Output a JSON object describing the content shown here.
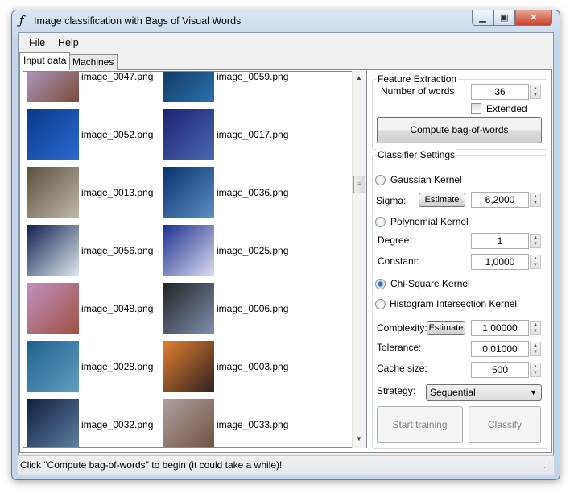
{
  "window": {
    "title": "Image classification with Bags of Visual Words",
    "icon": "script-f-icon",
    "minimize": "minimize-icon",
    "maximize": "maximize-icon",
    "close": "close-icon"
  },
  "menu": [
    "File",
    "Help"
  ],
  "tabs": [
    {
      "label": "Input data",
      "active": true
    },
    {
      "label": "Machines",
      "active": false
    }
  ],
  "images": [
    [
      "image_0047.png",
      "image_0059.png"
    ],
    [
      "image_0052.png",
      "image_0017.png"
    ],
    [
      "image_0013.png",
      "image_0036.png"
    ],
    [
      "image_0056.png",
      "image_0025.png"
    ],
    [
      "image_0048.png",
      "image_0006.png"
    ],
    [
      "image_0028.png",
      "image_0003.png"
    ],
    [
      "image_0032.png",
      "image_0033.png"
    ]
  ],
  "feature": {
    "title": "Feature Extraction",
    "words_label": "Number of words",
    "words": "36",
    "extended": "Extended",
    "extended_checked": false,
    "compute": "Compute bag-of-words"
  },
  "classifier": {
    "title": "Classifier Settings",
    "gaussian": "Gaussian Kernel",
    "sigma_label": "Sigma:",
    "estimate": "Estimate",
    "sigma": "6,2000",
    "polynomial": "Polynomial Kernel",
    "degree_label": "Degree:",
    "degree": "1",
    "constant_label": "Constant:",
    "constant": "1,0000",
    "chi": "Chi-Square Kernel",
    "histogram": "Histogram Intersection Kernel",
    "selected_kernel": "Chi-Square Kernel",
    "complexity_label": "Complexity:",
    "complexity": "1,00000",
    "tolerance_label": "Tolerance:",
    "tolerance": "0,01000",
    "cache_label": "Cache size:",
    "cache": "500",
    "strategy_label": "Strategy:",
    "strategy": "Sequential",
    "train": "Start training",
    "classify": "Classify"
  },
  "status": "Click \"Compute bag-of-words\" to begin (it could take a while)!"
}
